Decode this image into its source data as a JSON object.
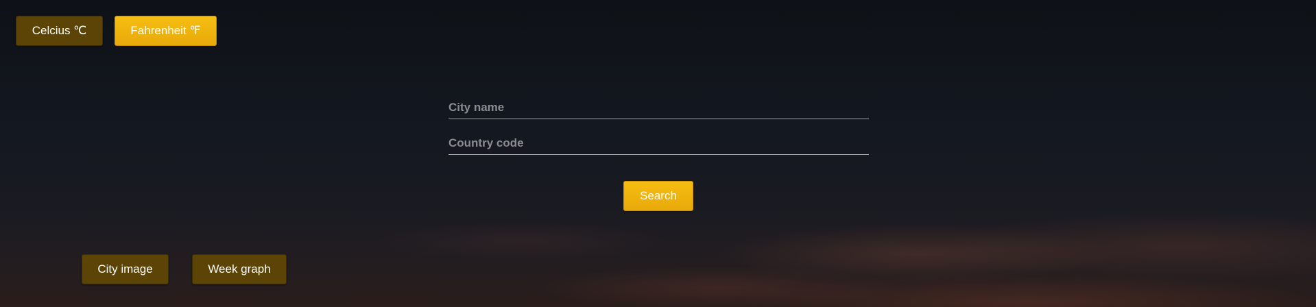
{
  "units": {
    "celsius_label": "Celcius ℃",
    "fahrenheit_label": "Fahrenheit ℉"
  },
  "search_form": {
    "city": {
      "value": "",
      "placeholder": "City name"
    },
    "country": {
      "value": "",
      "placeholder": "Country code"
    },
    "search_label": "Search"
  },
  "views": {
    "city_image_label": "City image",
    "week_graph_label": "Week graph"
  },
  "colors": {
    "accent": "#f0b50f",
    "accent_dark": "#5b4406",
    "background": "#10141b"
  }
}
